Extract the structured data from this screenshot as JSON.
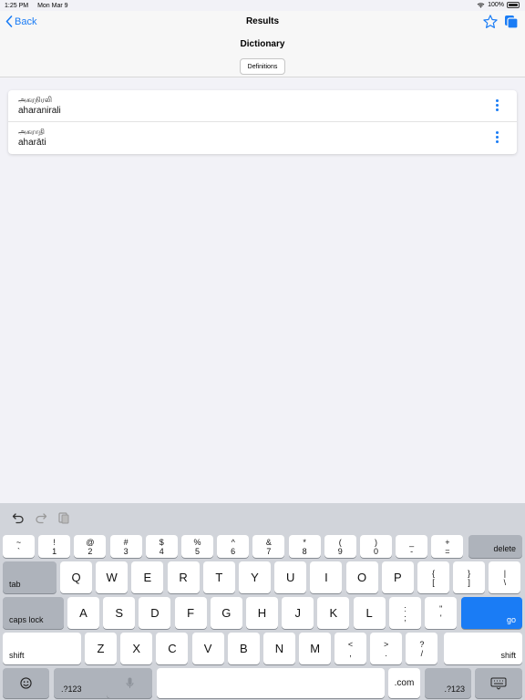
{
  "status": {
    "time": "1:25 PM",
    "date": "Mon Mar 9",
    "battery": "100%"
  },
  "nav": {
    "back": "Back",
    "title": "Results",
    "subtitle": "Dictionary",
    "segment": "Definitions"
  },
  "results": [
    {
      "tamil": "அகரநிரலி",
      "translit": "aharanirali"
    },
    {
      "tamil": "அகராதி",
      "translit": "aharāti"
    }
  ],
  "keyboard": {
    "num_row": [
      {
        "top": "~",
        "bottom": "`"
      },
      {
        "top": "!",
        "bottom": "1"
      },
      {
        "top": "@",
        "bottom": "2"
      },
      {
        "top": "#",
        "bottom": "3"
      },
      {
        "top": "$",
        "bottom": "4"
      },
      {
        "top": "%",
        "bottom": "5"
      },
      {
        "top": "^",
        "bottom": "6"
      },
      {
        "top": "&",
        "bottom": "7"
      },
      {
        "top": "*",
        "bottom": "8"
      },
      {
        "top": "(",
        "bottom": "9"
      },
      {
        "top": ")",
        "bottom": "0"
      },
      {
        "top": "_",
        "bottom": "-"
      },
      {
        "top": "+",
        "bottom": "="
      }
    ],
    "delete": "delete",
    "tab": "tab",
    "row_q": [
      "Q",
      "W",
      "E",
      "R",
      "T",
      "Y",
      "U",
      "I",
      "O",
      "P"
    ],
    "row_q_punct": [
      {
        "top": "{",
        "bottom": "["
      },
      {
        "top": "}",
        "bottom": "]"
      },
      {
        "top": "|",
        "bottom": "\\"
      }
    ],
    "caps": "caps lock",
    "row_a": [
      "A",
      "S",
      "D",
      "F",
      "G",
      "H",
      "J",
      "K",
      "L"
    ],
    "row_a_punct": [
      {
        "top": ":",
        "bottom": ";"
      },
      {
        "top": "\"",
        "bottom": "'"
      }
    ],
    "go": "go",
    "shift": "shift",
    "row_z": [
      "Z",
      "X",
      "C",
      "V",
      "B",
      "N",
      "M"
    ],
    "row_z_punct": [
      {
        "top": "<",
        "bottom": ","
      },
      {
        "top": ">",
        "bottom": "."
      },
      {
        "top": "?",
        "bottom": "/"
      }
    ],
    "numbers": ".?123",
    "dotcom": ".com"
  },
  "colors": {
    "accent": "#1a7cf5"
  }
}
